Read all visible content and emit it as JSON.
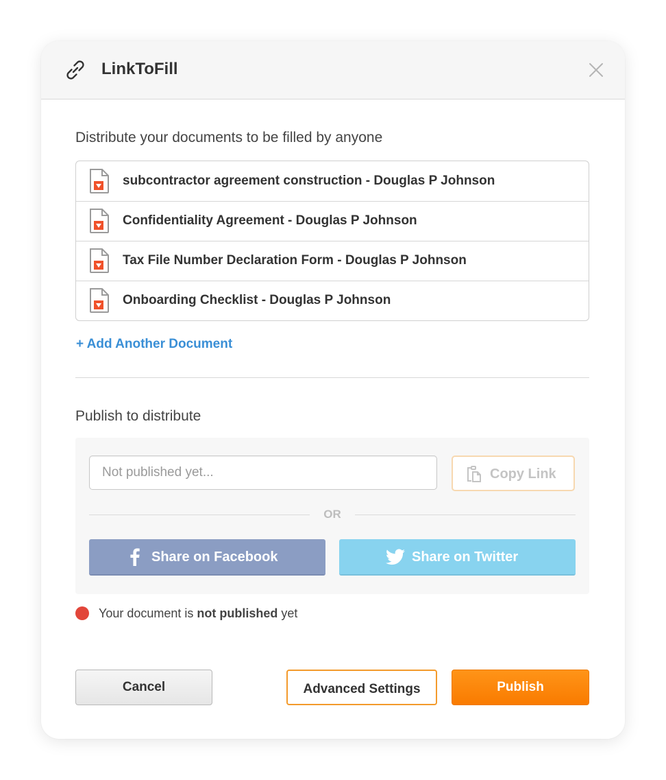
{
  "dialog": {
    "title": "LinkToFill",
    "icon": "link-icon",
    "close_icon": "close-icon"
  },
  "documents_section": {
    "heading": "Distribute your documents to be filled by anyone",
    "items": [
      {
        "name": "subcontractor agreement construction - Douglas P Johnson",
        "icon": "pdf-document-icon"
      },
      {
        "name": "Confidentiality Agreement - Douglas P Johnson",
        "icon": "pdf-document-icon"
      },
      {
        "name": "Tax File Number Declaration Form - Douglas P Johnson",
        "icon": "pdf-document-icon"
      },
      {
        "name": "Onboarding Checklist - Douglas P Johnson",
        "icon": "pdf-document-icon"
      }
    ],
    "add_link": "+ Add Another Document"
  },
  "publish_section": {
    "heading": "Publish to distribute",
    "link_input": {
      "value": "",
      "placeholder": "Not published yet..."
    },
    "copy_button": "Copy Link",
    "or_text": "OR",
    "facebook_button": "Share on Facebook",
    "twitter_button": "Share on Twitter"
  },
  "status": {
    "prefix": "Your document is ",
    "emphasis": "not published",
    "suffix": " yet",
    "color": "#e2463a"
  },
  "footer": {
    "cancel": "Cancel",
    "advanced": "Advanced Settings",
    "publish": "Publish"
  },
  "colors": {
    "accent_orange": "#f97b00",
    "link_blue": "#3a8fd6",
    "facebook": "#8b9dc3",
    "twitter": "#88d3ef"
  }
}
